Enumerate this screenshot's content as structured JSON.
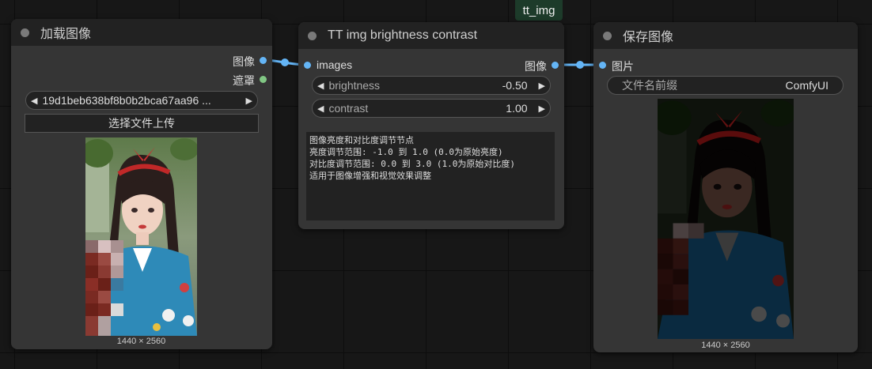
{
  "group_label": "tt_img",
  "load_node": {
    "title": "加载图像",
    "outputs": [
      "图像",
      "遮罩"
    ],
    "file_select": "19d1beb638bf8b0b2bca67aa96 ...",
    "upload_button": "选择文件上传",
    "image_size": "1440 × 2560"
  },
  "bc_node": {
    "title": "TT img brightness contrast",
    "input_label": "images",
    "output_label": "图像",
    "brightness_label": "brightness",
    "brightness_value": "-0.50",
    "contrast_label": "contrast",
    "contrast_value": "1.00",
    "description": "图像亮度和对比度调节节点\n亮度调节范围: -1.0 到 1.0 (0.0为原始亮度)\n对比度调节范围: 0.0 到 3.0 (1.0为原始对比度)\n适用于图像增强和视觉效果调整"
  },
  "save_node": {
    "title": "保存图像",
    "input_label": "图片",
    "prefix_label": "文件名前缀",
    "prefix_value": "ComfyUI",
    "image_size": "1440 × 2560"
  },
  "colors": {
    "image_slot": "#64b5f6",
    "mask_slot": "#81c784",
    "link": "#64b5f6",
    "group_bg": "#1d3b2a"
  }
}
